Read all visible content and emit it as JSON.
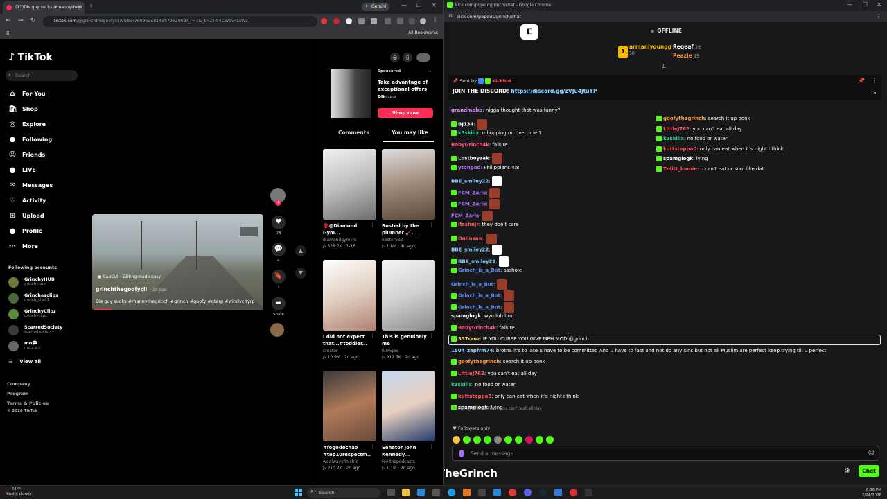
{
  "browser_left": {
    "tab_title": "(17)Dis guy sucks #mannythegr",
    "gemini": "Gemini",
    "url_host": "tiktok.com",
    "url_path": "/@grinchthegoofycli/video/7609525814387952909?_r=1&_t=ZT-94CWbv4LsWz",
    "all_bookmarks": "All Bookmarks"
  },
  "tiktok": {
    "logo": "TikTok",
    "search_placeholder": "Search",
    "nav": [
      {
        "label": "For You",
        "icon": "home-icon"
      },
      {
        "label": "Shop",
        "icon": "shop-icon"
      },
      {
        "label": "Explore",
        "icon": "compass-icon"
      },
      {
        "label": "Following",
        "icon": "following-icon"
      },
      {
        "label": "Friends",
        "icon": "friends-icon"
      },
      {
        "label": "LIVE",
        "icon": "live-icon"
      },
      {
        "label": "Messages",
        "icon": "messages-icon"
      },
      {
        "label": "Activity",
        "icon": "activity-icon"
      },
      {
        "label": "Upload",
        "icon": "upload-icon"
      },
      {
        "label": "Profile",
        "icon": "profile-icon"
      },
      {
        "label": "More",
        "icon": "more-icon"
      }
    ],
    "following_header": "Following accounts",
    "accounts": [
      {
        "name": "GrinchyHUB",
        "handle": "grinchyhub"
      },
      {
        "name": "Grinchesclips",
        "handle": "grinch_clips1"
      },
      {
        "name": "GrinchyClipz",
        "handle": "grinchyclipz"
      },
      {
        "name": "ScarredSociety",
        "handle": "scarredsociety"
      },
      {
        "name": "mo💬",
        "handle": "mo.x.x.s"
      }
    ],
    "view_all": "View all",
    "footer": [
      "Company",
      "Program",
      "Terms & Policies",
      "© 2026 TikTok"
    ],
    "video": {
      "capcut": "CapCut · Editing made easy",
      "user": "grinchthegoofycli",
      "age": "· 2d ago",
      "desc": "Dis guy sucks #mannythegrinch #grinch #goofy #gtarp #windycityrp"
    },
    "actions": {
      "likes": "28",
      "comments": "4",
      "saves": "1",
      "share": "Share"
    },
    "sponsored": {
      "label": "Sponsored",
      "text": "Take advantage of exceptional offers on ...",
      "brand": "BMW USA",
      "cta": "Shop now"
    },
    "tabs": [
      "Comments",
      "You may like"
    ],
    "cards": [
      {
        "title": "🥊@Diamond Gym...",
        "user": "diamondgymlife",
        "plays": "328.7K",
        "age": "1-16"
      },
      {
        "title": "Busted by the plumber 🪠...",
        "user": "nester502",
        "plays": "1.8M",
        "age": "4d ago"
      },
      {
        "title": "I did not expect that...#toddler...",
        "user": "creator___",
        "plays": "10.9M",
        "age": "2d ago"
      },
      {
        "title": "This is genuinely me",
        "user": "hilmgeo",
        "plays": "912.3K",
        "age": "2d ago"
      },
      {
        "title": "#fogodechao #top10respectm...",
        "user": "wealwaysfinishfc_",
        "plays": "210.2K",
        "age": "2d ago"
      },
      {
        "title": "Senator John Kennedy...",
        "user": "feelthepodcasts",
        "plays": "1.1M",
        "age": "2d ago"
      }
    ]
  },
  "browser_right": {
    "title": "kick.com/popout/grinch/chat - Google Chrome",
    "url": "kick.com/popout/grinch/chat"
  },
  "kick": {
    "status": "OFFLINE",
    "top_chatters": [
      {
        "name": "armaniyoungg",
        "count": "50"
      },
      {
        "name": "Reqeaf",
        "count": "26"
      },
      {
        "name": "Peazie",
        "count": "15"
      }
    ],
    "pinned": {
      "sent_by": "Sent by",
      "sender": "KickBot",
      "text": "JOIN THE DISCORD! ",
      "link": "https://discord.gg/zVJu4jtuYP"
    },
    "messages": [
      {
        "user": "grandmobb",
        "color": "#d98cff",
        "text": "nigga thought that was funny?",
        "emote": ""
      },
      {
        "user": "BJ134",
        "color": "#ffffff",
        "text": "",
        "emote": "red"
      },
      {
        "user": "k3skiiix",
        "color": "#2fd6a0",
        "text": "u hopping on overtime ?",
        "emote": ""
      },
      {
        "user": "BabyGrinch4k",
        "color": "#ff4f7a",
        "text": "failure",
        "emote": ""
      },
      {
        "user": "Lostboyzak",
        "color": "#ffffff",
        "text": "",
        "emote": "red"
      },
      {
        "user": "ytongod",
        "color": "#b574ff",
        "text": "Philippians 4:8",
        "emote": ""
      },
      {
        "user": "BBE_smiley22",
        "color": "#8fd3ff",
        "text": "",
        "emote": "white"
      },
      {
        "user": "FCM_Zaris",
        "color": "#b574ff",
        "text": "",
        "emote": "red"
      },
      {
        "user": "FCM_Zaris",
        "color": "#b574ff",
        "text": "",
        "emote": "red"
      },
      {
        "user": "FCM_Zaris",
        "color": "#b574ff",
        "text": "",
        "emote": "red"
      },
      {
        "user": "itsshnjr",
        "color": "#ff5b5b",
        "text": "they don't care",
        "emote": ""
      },
      {
        "user": "Dnlinsaw",
        "color": "#ff5b5b",
        "text": "",
        "emote": "red"
      },
      {
        "user": "BBE_smiley22",
        "color": "#8fd3ff",
        "text": "",
        "emote": "white"
      },
      {
        "user": "BBE_smiley22",
        "color": "#8fd3ff",
        "text": "",
        "emote": "white"
      },
      {
        "user": "Grinch_is_a_Bot",
        "color": "#5a8cff",
        "text": "asshole",
        "emote": ""
      },
      {
        "user": "Grinch_is_a_Bot",
        "color": "#5a8cff",
        "text": "",
        "emote": "red"
      },
      {
        "user": "Grinch_is_a_Bot",
        "color": "#5a8cff",
        "text": "",
        "emote": "red"
      },
      {
        "user": "Grinch_is_a_Bot",
        "color": "#5a8cff",
        "text": "",
        "emote": "red"
      },
      {
        "user": "spamglogk",
        "color": "#ffffff",
        "text": "wyo luh bro",
        "emote": ""
      },
      {
        "user": "BabyGrinch4k",
        "color": "#ff4f7a",
        "text": "failure",
        "emote": ""
      },
      {
        "user": "337cruz",
        "color": "#ffd84f",
        "text": "IF YOU CURSE YOU GIVE MEH MOD @grinch",
        "emote": ""
      },
      {
        "user": "1804_zapfrm74",
        "color": "#8fd3ff",
        "text": "brotha it's to late u have to be committed And u have to fast and not do any sins but not all Muslim are perfect keep trying till u perfect",
        "emote": ""
      },
      {
        "user": "goofythegrinch",
        "color": "#ff9a3c",
        "text": "search it up ponk",
        "emote": ""
      },
      {
        "user": "LittleJ762",
        "color": "#ff5b5b",
        "text": "you can't eat all day",
        "emote": ""
      },
      {
        "user": "k3skiiix",
        "color": "#2fd6a0",
        "text": "no food or water",
        "emote": ""
      },
      {
        "user": "kuttsteppa0",
        "color": "#ff5b5b",
        "text": "only can eat when it's night i think",
        "emote": ""
      },
      {
        "user": "spamglogk",
        "color": "#ffffff",
        "text": "lying",
        "emote": ""
      }
    ],
    "side_messages": [
      {
        "user": "goofythegrinch",
        "color": "#ff9a3c",
        "text": "search it up ponk"
      },
      {
        "user": "LittleJ762",
        "color": "#ff5b5b",
        "text": "you can't eat all day"
      },
      {
        "user": "k3skiiix",
        "color": "#2fd6a0",
        "text": "no food or water"
      },
      {
        "user": "kuttsteppa0",
        "color": "#ff5b5b",
        "text": "only can eat when it's night i think"
      },
      {
        "user": "spamglogk",
        "color": "#ffffff",
        "text": "lying"
      },
      {
        "user": "Zolitt_loonie",
        "color": "#ff5b5b",
        "text": "u can't eat or sum like dat"
      }
    ],
    "reply_note": "Replying to LittleJ762: you can't eat all day",
    "followers_only": "Followers only",
    "send_placeholder": "Send a message",
    "chat_button": "Chat",
    "watermark": "MannyTheGrinch"
  },
  "taskbar": {
    "temp": "44°F",
    "weather": "Mostly cloudy",
    "search": "Search",
    "time": "6:36 PM",
    "date": "2/24/2026"
  }
}
